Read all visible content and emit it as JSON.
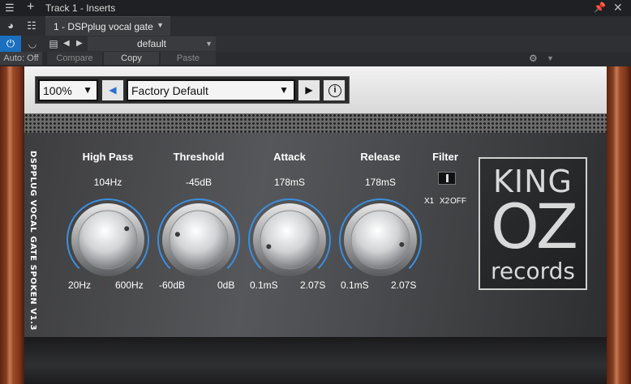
{
  "window": {
    "title": "Track 1 - Inserts",
    "insert_tab": "1 - DSPplug vocal gate"
  },
  "toolbar": {
    "preset_name": "default",
    "auto_label": "Auto: Off",
    "compare_label": "Compare",
    "copy_label": "Copy",
    "paste_label": "Paste"
  },
  "plugin": {
    "zoom": "100%",
    "preset": "Factory Default",
    "vertical_title": "DSPPLUG VOCAL GATE SPOKEN V1.3",
    "params": [
      {
        "label": "High Pass",
        "value": "104Hz",
        "min": "20Hz",
        "max": "600Hz",
        "level": 0.72
      },
      {
        "label": "Threshold",
        "value": "-45dB",
        "min": "-60dB",
        "max": "0dB",
        "level": 0.22
      },
      {
        "label": "Attack",
        "value": "178mS",
        "min": "0.1mS",
        "max": "2.07S",
        "level": 0.1
      },
      {
        "label": "Release",
        "value": "178mS",
        "min": "0.1mS",
        "max": "2.07S",
        "level": 0.88
      }
    ],
    "filter": {
      "label": "Filter",
      "opt1": "X1",
      "opt2": "X2",
      "opt3": "OFF"
    },
    "logo": {
      "line1": "KING",
      "line2": "OZ",
      "line3": "records"
    }
  },
  "colors": {
    "accent_blue": "#1b6fc0",
    "wood": "#a8502b",
    "knob_ring": "#3b8fe0"
  }
}
